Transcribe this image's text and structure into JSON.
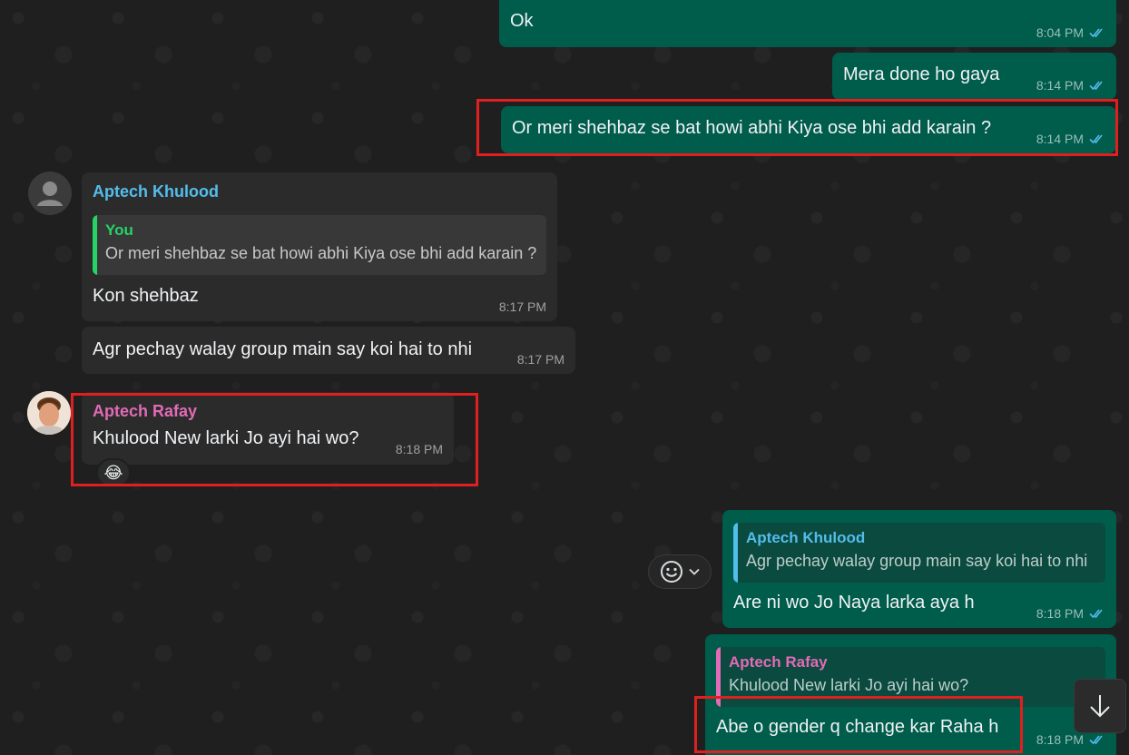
{
  "colors": {
    "outgoing_bubble": "#005c4b",
    "incoming_bubble": "#2b2b2b",
    "sender_khulood": "#53bdeb",
    "sender_rafay": "#e26ab6",
    "quote_you": "#25d366",
    "read_ticks": "#53bdeb",
    "highlight_box": "#e01f1f"
  },
  "messages": {
    "m1": {
      "text": "Ok",
      "time": "8:04 PM"
    },
    "m2": {
      "text": "Mera done ho gaya",
      "time": "8:14 PM"
    },
    "m3": {
      "text": "Or meri shehbaz se bat howi abhi Kiya ose bhi add karain ?",
      "time": "8:14 PM"
    },
    "m4": {
      "sender": "Aptech Khulood",
      "quote_name": "You",
      "quote_text": "Or meri shehbaz se bat howi abhi Kiya ose bhi add karain ?",
      "text": "Kon shehbaz",
      "time": "8:17 PM"
    },
    "m5": {
      "text": "Agr pechay walay group main say koi hai to nhi",
      "time": "8:17 PM"
    },
    "m6": {
      "sender": "Aptech Rafay",
      "text": "Khulood New larki Jo ayi hai wo?",
      "time": "8:18 PM",
      "reaction": "😂"
    },
    "m7": {
      "quote_name": "Aptech Khulood",
      "quote_text": "Agr pechay walay group main say koi hai to nhi",
      "text": "Are ni wo Jo Naya larka aya h",
      "time": "8:18 PM"
    },
    "m8": {
      "quote_name": "Aptech Rafay",
      "quote_text": "Khulood New larki Jo ayi hai wo?",
      "text": "Abe o gender q change kar Raha h",
      "time": "8:18 PM"
    }
  },
  "icons": {
    "read_receipt": "double-check-icon",
    "default_avatar": "user-silhouette-icon",
    "emoji_picker": "smiley-icon",
    "dropdown": "chevron-down-icon",
    "scroll_down": "arrow-down-icon"
  }
}
